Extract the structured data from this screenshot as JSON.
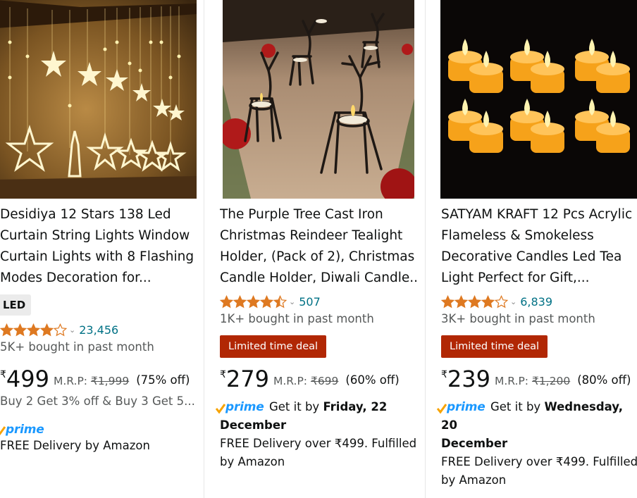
{
  "products": [
    {
      "title_lines": [
        "Desidiya 12 Stars 138 Led",
        "Curtain String Lights Window",
        "Curtain Lights with 8 Flashing",
        "Modes Decoration for..."
      ],
      "badge": "LED",
      "rating": 4.0,
      "review_count": "23,456",
      "bought": "5K+ bought in past month",
      "currency": "₹",
      "price": "499",
      "mrp_label": "M.R.P:",
      "mrp": "₹1,999",
      "discount": "(75% off)",
      "offer": "Buy 2 Get 3% off & Buy 3 Get 5...",
      "prime": "prime",
      "delivery": "FREE Delivery by Amazon"
    },
    {
      "title_lines": [
        "The Purple Tree Cast Iron",
        "Christmas Reindeer Tealight",
        "Holder, (Pack of 2), Christmas",
        "Candle Holder, Diwali Candle..."
      ],
      "rating": 4.5,
      "review_count": "507",
      "bought": "1K+ bought in past month",
      "deal": "Limited time deal",
      "currency": "₹",
      "price": "279",
      "mrp_label": "M.R.P:",
      "mrp": "₹699",
      "discount": "(60% off)",
      "prime": "prime",
      "get_it": "Get it by",
      "get_it_date_1": "Friday, 22",
      "get_it_date_2": "December",
      "delivery_1": "FREE Delivery over ₹499. Fulfilled",
      "delivery_2": "by Amazon"
    },
    {
      "title_lines": [
        "SATYAM KRAFT 12 Pcs Acrylic",
        "Flameless & Smokeless",
        "Decorative Candles Led Tea",
        "Light Perfect for Gift,..."
      ],
      "rating": 4.0,
      "review_count": "6,839",
      "bought": "3K+ bought in past month",
      "deal": "Limited time deal",
      "currency": "₹",
      "price": "239",
      "mrp_label": "M.R.P:",
      "mrp": "₹1,200",
      "discount": "(80% off)",
      "prime": "prime",
      "get_it": "Get it by",
      "get_it_date_1": "Wednesday, 20",
      "get_it_date_2": "December",
      "delivery_1": "FREE Delivery over ₹499. Fulfilled",
      "delivery_2": "by Amazon"
    }
  ],
  "colors": {
    "star": "#de7921",
    "link": "#007185",
    "deal": "#b12704",
    "prime": "#1a98ff"
  }
}
